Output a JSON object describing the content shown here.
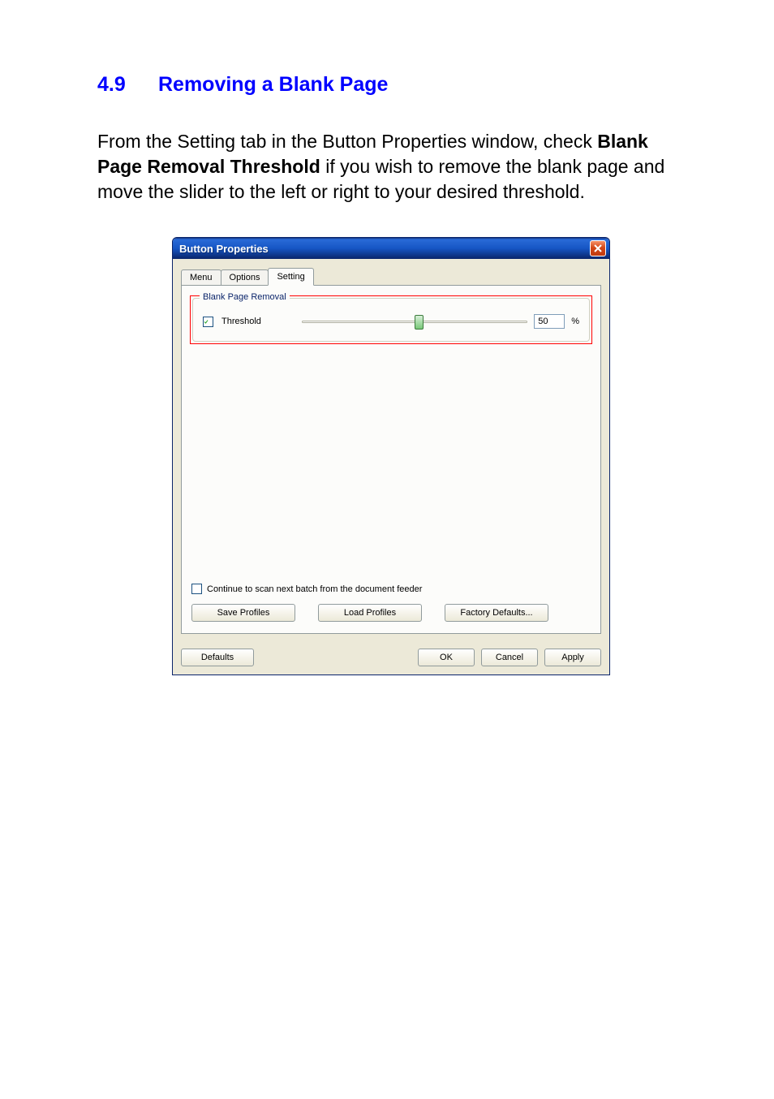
{
  "doc": {
    "section_number": "4.9",
    "section_title": "Removing a Blank Page",
    "paragraph_pre": "From the Setting tab in the Button Properties window, check ",
    "paragraph_bold": "Blank Page Removal Threshold",
    "paragraph_post": " if you wish to remove the blank page and move the slider to the left or right to your desired threshold."
  },
  "window": {
    "title": "Button Properties",
    "tabs": {
      "menu": "Menu",
      "options": "Options",
      "setting": "Setting"
    },
    "group_legend": "Blank Page Removal",
    "threshold_label": "Threshold",
    "threshold_value": "50",
    "threshold_unit": "%",
    "continue_label": "Continue to scan next batch from the document feeder",
    "buttons": {
      "save_profiles": "Save Profiles",
      "load_profiles": "Load Profiles",
      "factory_defaults": "Factory Defaults...",
      "defaults": "Defaults",
      "ok": "OK",
      "cancel": "Cancel",
      "apply": "Apply"
    }
  }
}
